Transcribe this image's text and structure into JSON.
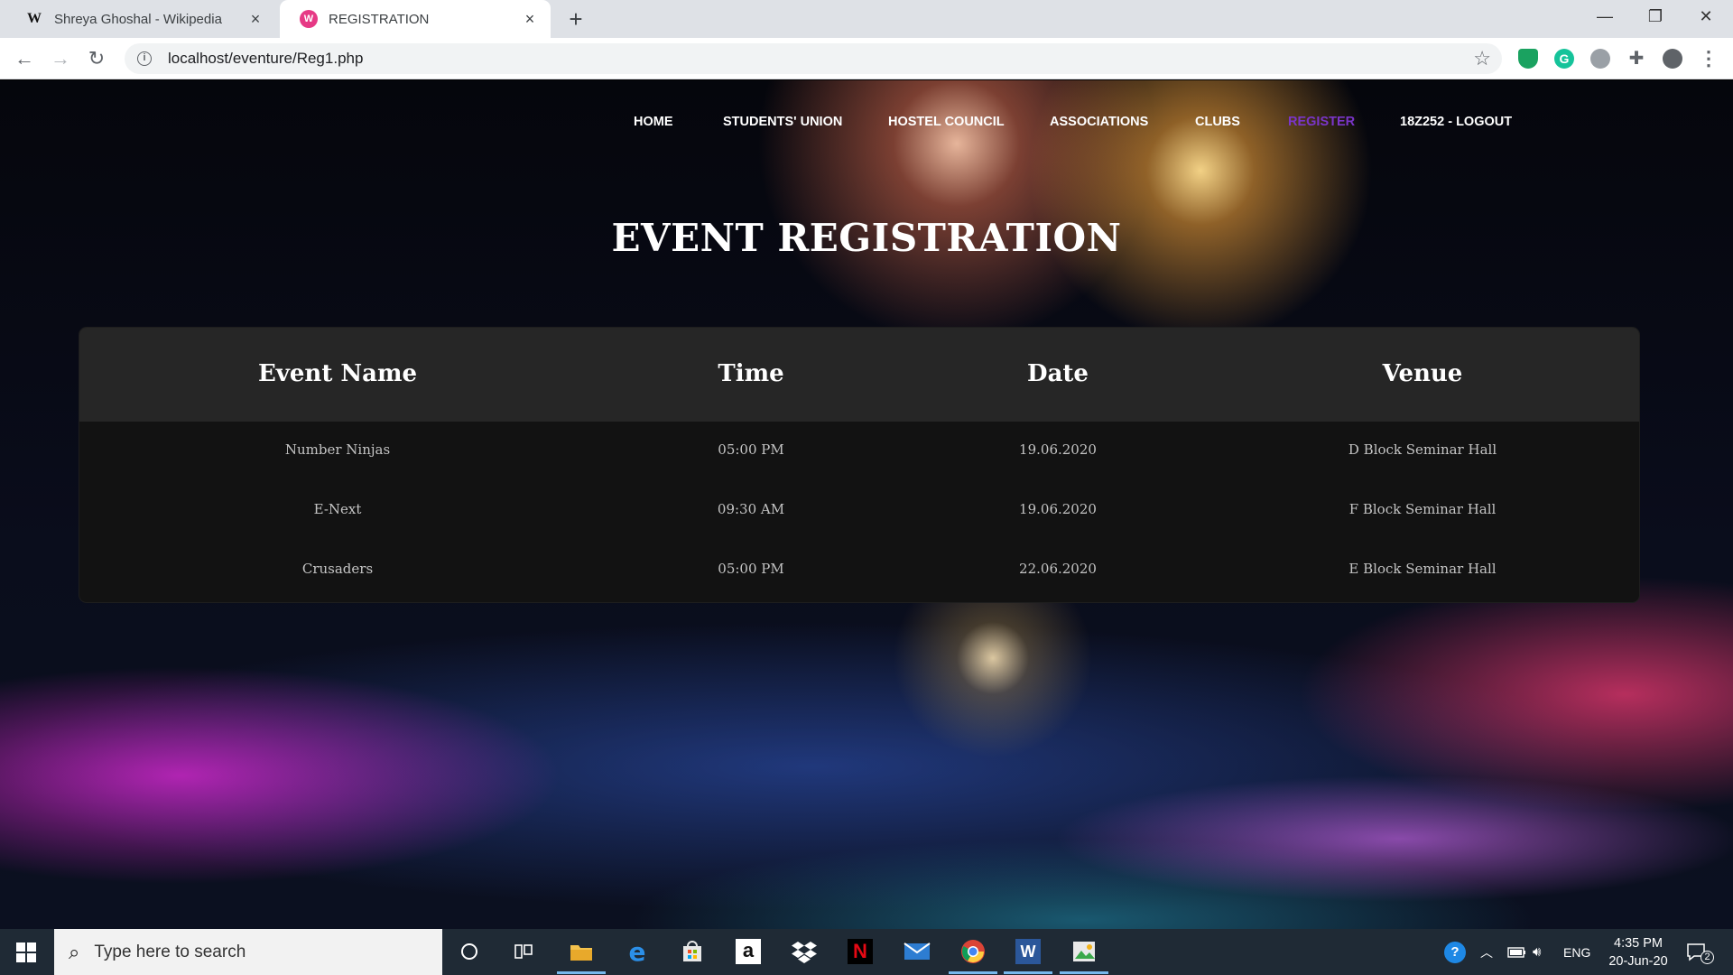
{
  "browser": {
    "tabs": [
      {
        "favicon": "W",
        "title": "Shreya Ghoshal - Wikipedia",
        "active": false
      },
      {
        "favicon": "W",
        "title": "REGISTRATION",
        "active": true
      }
    ],
    "new_tab_symbol": "+",
    "close_symbol": "×",
    "url": "localhost/eventure/Reg1.php",
    "nav": {
      "back": "←",
      "forward": "→",
      "reload": "↻"
    },
    "window_controls": {
      "minimize": "—",
      "restore": "❐",
      "close": "✕"
    },
    "extensions": [
      "shield-extension-icon",
      "grammarly-icon",
      "circle-extension-icon",
      "puzzle-icon",
      "profile-icon",
      "menu-icon"
    ]
  },
  "site": {
    "nav": [
      "HOME",
      "STUDENTS' UNION",
      "HOSTEL COUNCIL",
      "ASSOCIATIONS",
      "CLUBS",
      "REGISTER",
      "18Z252 - LOGOUT"
    ],
    "active_nav": "REGISTER",
    "active_color": "#7a35c9",
    "heading": "EVENT REGISTRATION",
    "table": {
      "headers": [
        "Event Name",
        "Time",
        "Date",
        "Venue"
      ],
      "rows": [
        [
          "Number Ninjas",
          "05:00 PM",
          "19.06.2020",
          "D Block Seminar Hall"
        ],
        [
          "E-Next",
          "09:30 AM",
          "19.06.2020",
          "F Block Seminar Hall"
        ],
        [
          "Crusaders",
          "05:00 PM",
          "22.06.2020",
          "E Block Seminar Hall"
        ]
      ]
    }
  },
  "taskbar": {
    "search_placeholder": "Type here to search",
    "apps": [
      "cortana-icon",
      "task-view-icon",
      "file-explorer-icon",
      "edge-icon",
      "store-icon",
      "amazon-icon",
      "dropbox-icon",
      "netflix-icon",
      "mail-icon",
      "chrome-icon",
      "word-icon",
      "photos-icon"
    ],
    "language": "ENG",
    "time": "4:35 PM",
    "date": "20-Jun-20",
    "notification_count": "2"
  }
}
